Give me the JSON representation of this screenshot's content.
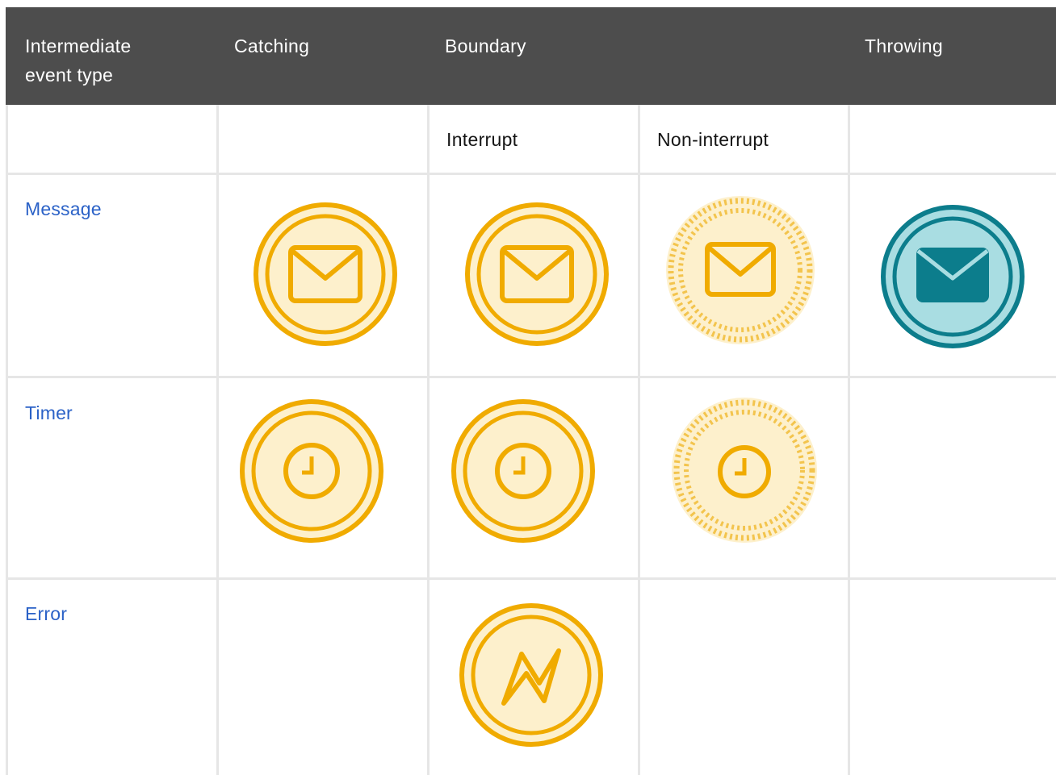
{
  "table": {
    "header": {
      "col_type": "Intermediate event type",
      "col_type_line1": "Intermediate",
      "col_type_line2": "event type",
      "col_catching": "Catching",
      "col_boundary": "Boundary",
      "col_throwing": "Throwing"
    },
    "subheader": {
      "interrupt": "Interrupt",
      "non_interrupt": "Non-interrupt"
    },
    "rows": [
      {
        "label": "Message",
        "catching": "message-catching-icon",
        "interrupt": "message-boundary-interrupt-icon",
        "non_interrupt": "message-boundary-non-interrupt-icon",
        "throwing": "message-throwing-icon"
      },
      {
        "label": "Timer",
        "catching": "timer-catching-icon",
        "interrupt": "timer-boundary-interrupt-icon",
        "non_interrupt": "timer-boundary-non-interrupt-icon",
        "throwing": ""
      },
      {
        "label": "Error",
        "catching": "",
        "interrupt": "error-boundary-interrupt-icon",
        "non_interrupt": "",
        "throwing": ""
      }
    ]
  },
  "colors": {
    "header_bg": "#4d4d4d",
    "link": "#2b62c7",
    "catch_yellow": "#f0ab00",
    "catch_fill": "#fdf0cc",
    "throw_teal": "#0c7d8c",
    "throw_fill": "#a9dde2"
  }
}
